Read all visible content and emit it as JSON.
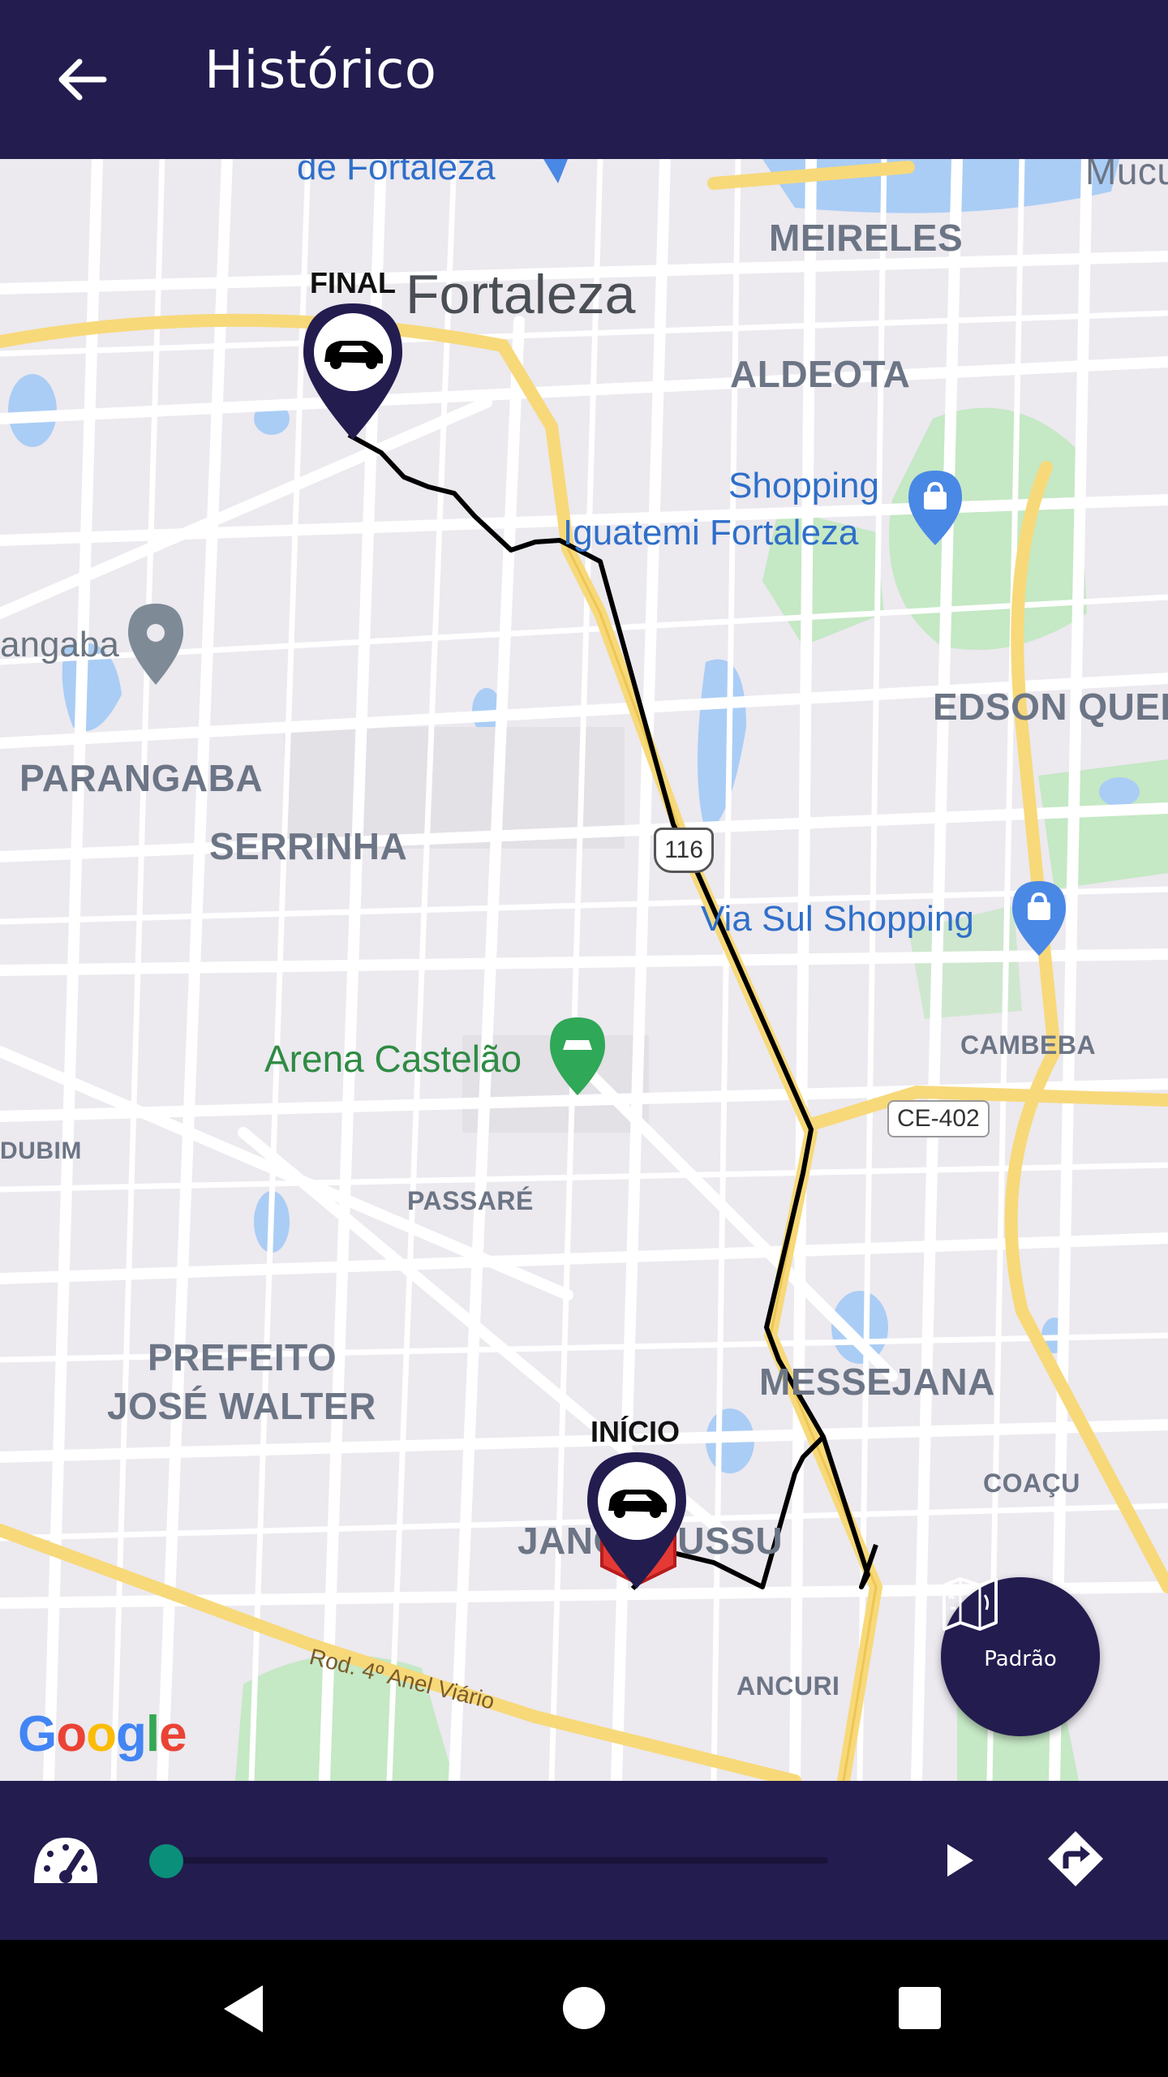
{
  "header": {
    "title": "Histórico",
    "back_icon": "arrow-left-icon"
  },
  "map": {
    "city_label": "Fortaleza",
    "districts": {
      "meireles": "MEIRELES",
      "aldeota": "ALDEOTA",
      "edson": "EDSON QUEI",
      "parangaba": "PARANGABA",
      "serrinha": "SERRINHA",
      "cambeba": "CAMBEBA",
      "dubim": "DUBIM",
      "passare": "PASSARÉ",
      "prefeito": "PREFEITO",
      "jose_walter": "JOSÉ WALTER",
      "messejana": "MESSEJANA",
      "coacu": "COAÇU",
      "jangurussu": "JANGURUSSU",
      "ancuri": "ANCURI",
      "mucuripe": "Mucu"
    },
    "pois": {
      "top_left": "de Fortaleza",
      "shopping_line1": "Shopping",
      "shopping_line2": "Iguatemi Fortaleza",
      "parangaba_lagoa": "angaba",
      "via_sul": "Via Sul Shopping",
      "arena": "Arena Castelão"
    },
    "roads": {
      "br116": "116",
      "ce402": "CE-402",
      "anel_viario": "Rod. 4º Anel Viário"
    },
    "markers": {
      "final_label": "FINAL",
      "start_label": "INÍCIO",
      "marker_icon": "car-icon"
    },
    "attribution": {
      "G": "G",
      "o1": "o",
      "o2": "o",
      "g": "g",
      "l": "l",
      "e": "e",
      "colors": [
        "#4285F4",
        "#EA4335",
        "#FBBC05",
        "#4285F4",
        "#34A853",
        "#EA4335"
      ]
    },
    "map_type_button": {
      "label": "Padrão",
      "icon": "map-icon"
    }
  },
  "playback": {
    "speed_icon": "speedometer-icon",
    "progress": 0,
    "play_icon": "play-icon",
    "directions_icon": "directions-icon",
    "accent_color": "#0a8f7a",
    "bar_color": "#231c4f"
  },
  "system_nav": {
    "back_icon": "nav-back-icon",
    "home_icon": "nav-home-icon",
    "recents_icon": "nav-recents-icon"
  }
}
